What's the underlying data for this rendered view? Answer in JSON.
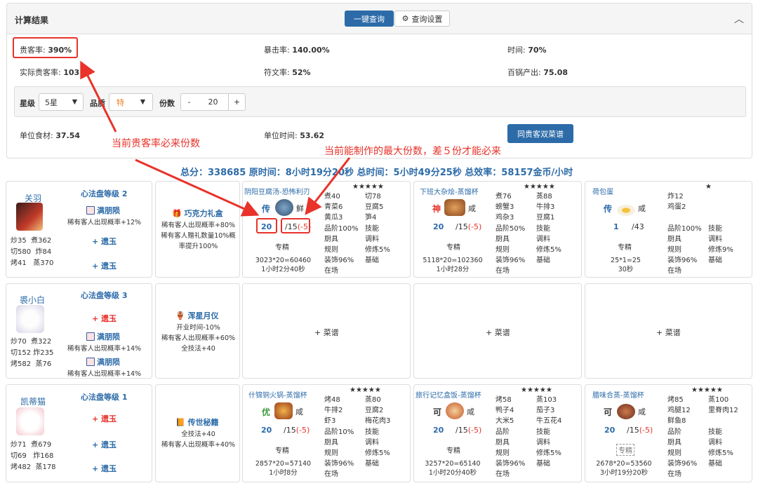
{
  "panel": {
    "title": "计算结果",
    "query_button": "一键查询",
    "settings_button": "查询设置"
  },
  "stats": {
    "guest_rate_label": "贵客率:",
    "guest_rate_value": "390%",
    "crit_label": "暴击率:",
    "crit_value": "140.00%",
    "time_label": "时间:",
    "time_value": "70%",
    "actual_guest_label": "实际贵客率:",
    "actual_guest_value": "103 %",
    "rune_label": "符文率:",
    "rune_value": "52%",
    "pot_label": "百锅产出:",
    "pot_value": "75.08"
  },
  "filters": {
    "star_label": "星级",
    "star_value": "5星",
    "quality_label": "品质",
    "quality_value": "特",
    "count_label": "份数",
    "minus": "-",
    "count_value": "20",
    "plus": "+"
  },
  "unit": {
    "food_label": "单位食材:",
    "food_value": "37.54",
    "time_label": "单位时间:",
    "time_value": "53.62",
    "double_button": "同贵客双菜谱"
  },
  "annotations": {
    "a1": "当前贵客率必来份数",
    "a2": "当前能制作的最大份数，差５份才能必来"
  },
  "summary": "总分：338685 原时间：8小时19分20秒 总时间：5小时49分25秒 总效率：58157金币/小时",
  "chefs": [
    {
      "name": "关羽",
      "title": "心法盘等级 2",
      "skills": [
        "炒35",
        "煮362",
        "切580",
        "炸84",
        "烤41",
        "蒸370"
      ],
      "equip": "满朋陨",
      "equip_desc": "稀有客人出现概率+12%",
      "add1": "+ 遗玉",
      "add2": "+ 遗玉",
      "item": {
        "name": "巧克力礼盒",
        "desc": [
          "稀有客人出现概率+80%",
          "稀有客人赠礼数量10%概",
          "率提升100%"
        ]
      }
    },
    {
      "name": "裘小白",
      "title": "心法盘等级 3",
      "skills": [
        "炒70",
        "煮322",
        "切152",
        "炸235",
        "烤582",
        "蒸76"
      ],
      "add1": "+ 遗玉",
      "equip": "满朋陨",
      "equip_desc": "稀有客人出现概率+14%",
      "equip2": "满朋陨",
      "equip2_desc": "稀有客人出现概率+14%",
      "item": {
        "name": "浑星月仪",
        "desc": [
          "开业时间-10%",
          "稀有客人出现概率+60%",
          "全技法+40"
        ]
      }
    },
    {
      "name": "凯蒂猫",
      "title": "心法盘等级 1",
      "skills": [
        "炒71",
        "煮679",
        "切69",
        "炸168",
        "烤482",
        "蒸178"
      ],
      "add1": "+ 遗玉",
      "add2": "+ 遗玉",
      "add3": "+ 遗玉",
      "item": {
        "name": "传世秘籍",
        "desc": [
          "全技法+40",
          "稀有客人出现概率+40%"
        ]
      }
    }
  ],
  "recipes": [
    {
      "name": "阴阳豆腐汤-恐怖利刃",
      "stars": "★★★★★",
      "grade": "传",
      "taste": "鲜",
      "count": "20",
      "max": "/15",
      "diff": "(-5)",
      "expert": "专精",
      "calc": "3023*20=60460",
      "time": "1小时2分40秒",
      "right": [
        [
          "煮40",
          "切78"
        ],
        [
          "青菜6",
          "豆腐5"
        ],
        [
          "黄瓜3",
          "笋4"
        ],
        [
          "品阶100%",
          "技能"
        ],
        [
          "厨具",
          "调料"
        ],
        [
          "规则",
          "修炼5%"
        ],
        [
          "装饰96%",
          "基础"
        ],
        [
          "在场",
          ""
        ]
      ]
    },
    {
      "name": "下班大杂烩-蒸馏杯",
      "stars": "★★★★★",
      "grade": "神",
      "taste": "咸",
      "count": "20",
      "max": "/15",
      "diff": "(-5)",
      "expert": "专精",
      "calc": "5118*20=102360",
      "time": "1小时28分",
      "right": [
        [
          "煮76",
          "蒸88"
        ],
        [
          "螃蟹3",
          "牛排3"
        ],
        [
          "鸡杂3",
          "豆腐1"
        ],
        [
          "品阶50%",
          "技能"
        ],
        [
          "厨具",
          "调料"
        ],
        [
          "规则",
          "修炼5%"
        ],
        [
          "装饰96%",
          "基础"
        ],
        [
          "在场",
          ""
        ]
      ]
    },
    {
      "name": "荷包蛋",
      "stars": "★",
      "grade": "传",
      "taste": "咸",
      "count": "1",
      "max": "/43",
      "diff": "",
      "expert": "专精",
      "calc": "25*1=25",
      "time": "30秒",
      "right": [
        [
          "炸12",
          ""
        ],
        [
          "鸡蛋2",
          ""
        ],
        [
          "",
          ""
        ],
        [
          "品阶100%",
          "技能"
        ],
        [
          "厨具",
          "调料"
        ],
        [
          "规则",
          "修炼9%"
        ],
        [
          "装饰96%",
          "基础"
        ],
        [
          "在场",
          ""
        ]
      ]
    },
    {
      "name": "什锦铜火锅-蒸馏杯",
      "stars": "★★★★★",
      "grade": "优",
      "taste": "咸",
      "count": "20",
      "max": "/15",
      "diff": "(-5)",
      "expert": "专精",
      "calc": "2857*20=57140",
      "time": "1小时8分",
      "right": [
        [
          "烤48",
          "蒸80"
        ],
        [
          "牛排2",
          "豆腐2"
        ],
        [
          "虾3",
          "梅花肉3"
        ],
        [
          "品阶10%",
          "技能"
        ],
        [
          "厨具",
          "调料"
        ],
        [
          "规则",
          "修炼5%"
        ],
        [
          "装饰96%",
          "基础"
        ],
        [
          "在场",
          ""
        ]
      ]
    },
    {
      "name": "旅行记忆盒饭-蒸馏杯",
      "stars": "★★★★★",
      "grade": "可",
      "taste": "咸",
      "count": "20",
      "max": "/15",
      "diff": "(-5)",
      "expert": "专精",
      "calc": "3257*20=65140",
      "time": "1小时20分40秒",
      "right": [
        [
          "烤58",
          "蒸103"
        ],
        [
          "鸭子4",
          "茄子3"
        ],
        [
          "大米5",
          "牛五花4"
        ],
        [
          "品阶",
          "技能"
        ],
        [
          "厨具",
          "调料"
        ],
        [
          "规则",
          "修炼5%"
        ],
        [
          "装饰96%",
          "基础"
        ],
        [
          "在场",
          ""
        ]
      ]
    },
    {
      "name": "腊味合蒸-蒸馏杯",
      "stars": "★★★★★",
      "grade": "可",
      "taste": "咸",
      "count": "20",
      "max": "/15",
      "diff": "(-5)",
      "expert": "专精",
      "calc": "2678*20=53560",
      "time": "3小时19分20秒",
      "right": [
        [
          "烤85",
          "蒸100"
        ],
        [
          "鸡腿12",
          "里脊肉12"
        ],
        [
          "鲜鱼8",
          ""
        ],
        [
          "品阶",
          "技能"
        ],
        [
          "厨具",
          "调料"
        ],
        [
          "规则",
          "修炼5%"
        ],
        [
          "装饰96%",
          "基础"
        ],
        [
          "在场",
          ""
        ]
      ]
    }
  ],
  "add_recipe": "+ 菜谱"
}
